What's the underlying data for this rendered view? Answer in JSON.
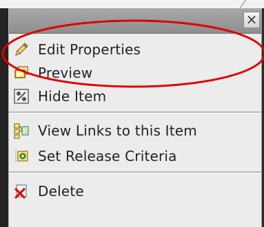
{
  "window": {
    "close_label": "×"
  },
  "menu": {
    "items": [
      {
        "label": "Edit Properties",
        "icon": "pencil-icon"
      },
      {
        "label": "Preview",
        "icon": "preview-window-icon"
      },
      {
        "label": "Hide Item",
        "icon": "hide-item-icon"
      },
      {
        "label": "View Links to this Item",
        "icon": "links-icon"
      },
      {
        "label": "Set Release Criteria",
        "icon": "release-criteria-icon"
      },
      {
        "label": "Delete",
        "icon": "delete-x-icon"
      }
    ]
  },
  "colors": {
    "annotation": "#e00000",
    "menu_bg": "#ececec",
    "header": "#9a9a9a"
  }
}
